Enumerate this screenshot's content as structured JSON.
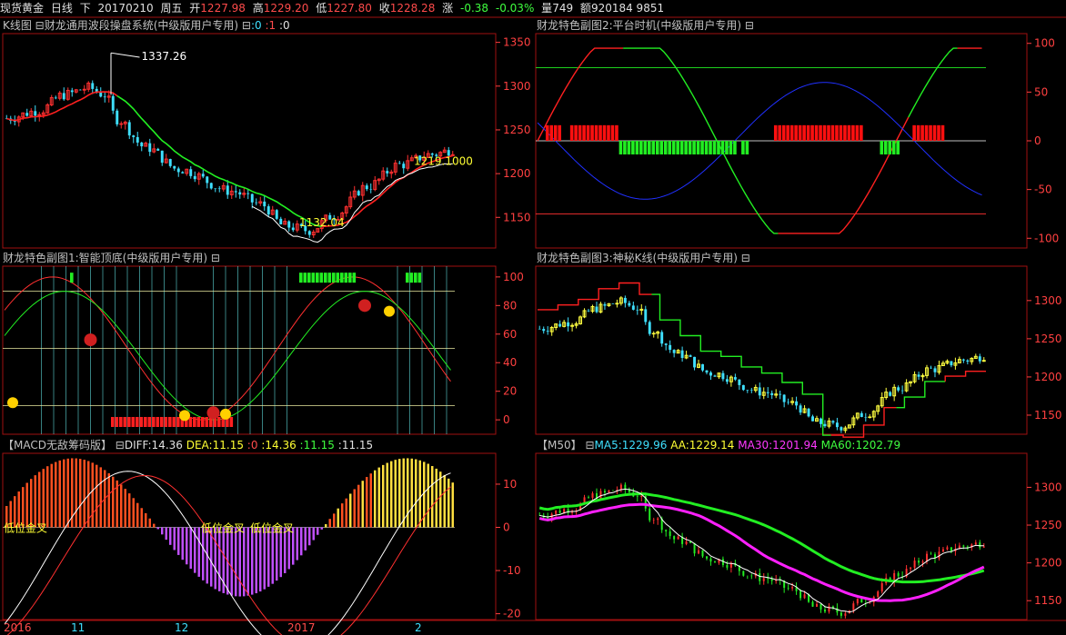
{
  "topbar": {
    "instrument": "现货黄金",
    "period": "日线",
    "dir": "下",
    "date": "20170210",
    "weekday": "周五",
    "open_label": "开",
    "open": "1227.98",
    "high_label": "高",
    "high": "1229.20",
    "low_label": "低",
    "low": "1227.80",
    "close_label": "收",
    "close": "1228.28",
    "chg_label": "涨",
    "chg": "-0.38",
    "chg_pct": "-0.03%",
    "vol_label": "量",
    "vol": "749",
    "amt_label": "额",
    "amt": "920184 9851"
  },
  "panels": {
    "kline": {
      "title": "K线图 ⊟财龙通用波段操盘系统(中级版用户专用) ⊟",
      "c0": ":0",
      "c1": ":1",
      "c2": ":0",
      "ann_high": "1337.26",
      "ann_low": "1132.04",
      "ann_last": "1219.1000",
      "axis": [
        "1350",
        "1300",
        "1250",
        "1200",
        "1150"
      ]
    },
    "sub1": {
      "title": "财龙特色副图1:智能顶底(中级版用户专用) ⊟",
      "axis": [
        "100",
        "80",
        "60",
        "40",
        "20",
        "0"
      ]
    },
    "macd": {
      "title": "【MACD无敌筹码版】 ⊟",
      "diff_label": "DIFF:",
      "diff": "14.36",
      "dea_label": "DEA:",
      "dea": "11.15",
      "v3": ":0",
      "v4": ":14.36",
      "v5": ":11.15",
      "v6": ":11.15",
      "ann1": "低位金叉",
      "ann2": "低位金叉",
      "ann3": "低位金叉",
      "axis": [
        "10",
        "0",
        "-10",
        "-20"
      ]
    },
    "sub2": {
      "title": "财龙特色副图2:平台时机(中级版用户专用) ⊟",
      "axis": [
        "100",
        "50",
        "0",
        "-50",
        "-100"
      ]
    },
    "sub3": {
      "title": "财龙特色副图3:神秘K线(中级版用户专用) ⊟",
      "axis": [
        "1300",
        "1250",
        "1200",
        "1150"
      ]
    },
    "ma": {
      "title": "【M50】 ⊟",
      "ma5_label": "MA5:",
      "ma5": "1229.96",
      "aa_label": "AA:",
      "aa": "1229.14",
      "ma30_label": "MA30:",
      "ma30": "1201.94",
      "ma60_label": "MA60:",
      "ma60": "1202.79",
      "axis": [
        "1300",
        "1250",
        "1200",
        "1150"
      ]
    }
  },
  "dates": [
    "2016",
    "11",
    "12",
    "2017",
    "2"
  ],
  "colors": {
    "up": "#ff3030",
    "down": "#3fe0ff",
    "grid": "#a01010",
    "ma_green": "#22ee22",
    "ma_mag": "#ff20ff"
  }
}
